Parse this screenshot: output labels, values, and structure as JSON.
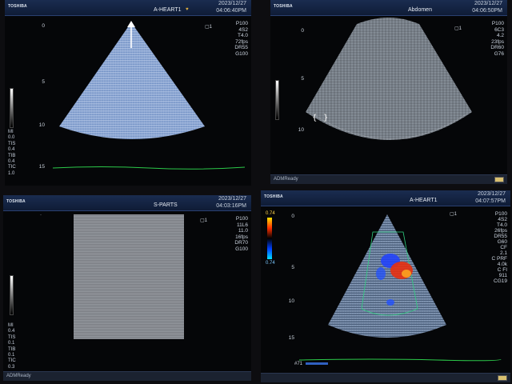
{
  "panels": {
    "p1": {
      "brand": "TOSHIBA",
      "preset": "A-HEART1",
      "date": "2023/12/27",
      "time": "04:06:40PM",
      "params": [
        "P100",
        "4S2",
        "T4.0",
        "72fps",
        "DR55",
        "G100"
      ],
      "scale": [
        "0",
        "5",
        "10",
        "15"
      ],
      "mi": [
        "MI",
        "0.0",
        "TIS",
        "0.4",
        "TIB",
        "0.4",
        "TIC",
        "1.0"
      ],
      "marker": "1"
    },
    "p2": {
      "brand": "TOSHIBA",
      "preset": "Abdomen",
      "date": "2023/12/27",
      "time": "04:06:50PM",
      "params": [
        "P100",
        "6C3",
        "4.2",
        "23fps",
        "DR60",
        "G76"
      ],
      "scale": [
        "0",
        "5",
        "10"
      ],
      "footer": "ADMReady",
      "marker": "1"
    },
    "p3": {
      "brand": "TOSHIBA",
      "preset": "S-PARTS",
      "date": "2023/12/27",
      "time": "04:03:16PM",
      "params": [
        "P100",
        "11L6",
        "11.0",
        "16fps",
        "DR70",
        "G100"
      ],
      "mi": [
        "MI",
        "0.4",
        "TIS",
        "0.1",
        "TIB",
        "0.1",
        "TIC",
        "0.3"
      ],
      "footer": "ADMReady",
      "marker": "1"
    },
    "p4": {
      "brand": "TOSHIBA",
      "preset": "A-HEART1",
      "date": "2023/12/27",
      "time": "04:07:57PM",
      "params": [
        "P100",
        "4S2",
        "T4.0",
        "26fps",
        "DR55",
        "G60",
        "CF",
        "2.1",
        "C PRF",
        "4.0k",
        "C FI",
        "911",
        "CG19"
      ],
      "color_top": "0.74",
      "color_bottom": "0.74",
      "scale": [
        "0",
        "5",
        "10",
        "15"
      ],
      "footer_left": "#71",
      "marker": "1"
    }
  }
}
